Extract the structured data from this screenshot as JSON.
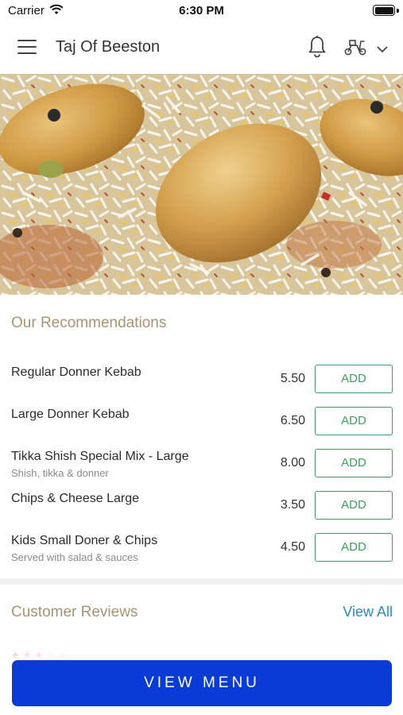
{
  "status_bar": {
    "carrier": "Carrier",
    "time": "6:30 PM",
    "icons": [
      "wifi-icon",
      "battery-icon"
    ]
  },
  "header": {
    "title": "Taj Of Beeston",
    "icons": [
      "menu-icon",
      "bell-icon",
      "scooter-icon",
      "chevron-down-icon"
    ]
  },
  "hero": {
    "image": "chicken biryani dish"
  },
  "recommendations": {
    "title": "Our Recommendations",
    "add_label": "ADD",
    "items": [
      {
        "name": "Regular Donner Kebab",
        "description": "",
        "price": "5.50"
      },
      {
        "name": "Large Donner Kebab",
        "description": "",
        "price": "6.50"
      },
      {
        "name": "Tikka Shish Special Mix - Large",
        "description": "Shish, tikka & donner",
        "price": "8.00"
      },
      {
        "name": "Chips & Cheese Large",
        "description": "",
        "price": "3.50"
      },
      {
        "name": "Kids Small Doner & Chips",
        "description": "Served with salad & sauces",
        "price": "4.50"
      }
    ]
  },
  "reviews": {
    "title": "Customer Reviews",
    "view_all": "View All"
  },
  "footer": {
    "view_menu": "VIEW MENU"
  },
  "colors": {
    "accent_gold": "#a89372",
    "add_green": "#3e9e5b",
    "link_blue": "#2b8bc0",
    "primary_button": "#0b3bd6",
    "star_red": "#e53935"
  }
}
